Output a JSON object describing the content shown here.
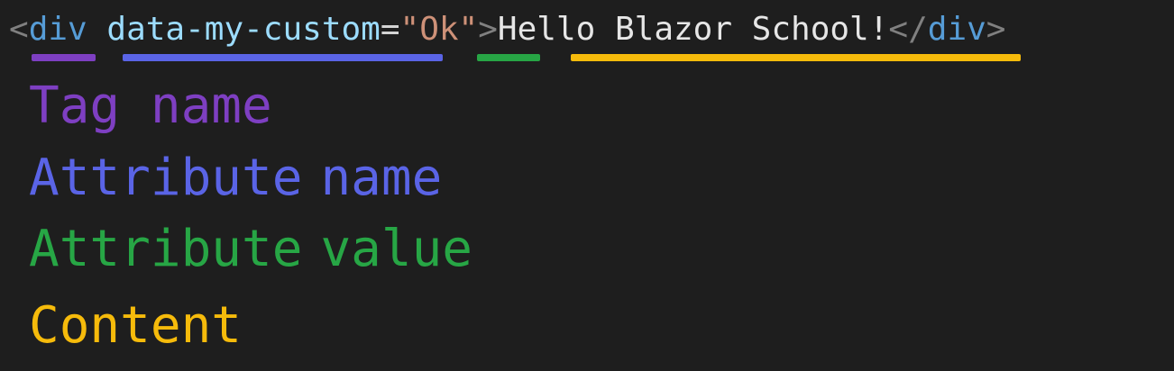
{
  "code": {
    "open_bracket": "<",
    "tag_name": "div",
    "space": " ",
    "attribute_name": "data-my-custom",
    "equals": "=",
    "attribute_value": "\"Ok\"",
    "close_bracket": ">",
    "content": "Hello Blazor School!",
    "end_tag_open": "</",
    "end_tag_name": "div",
    "end_tag_close": ">"
  },
  "legend": {
    "tag": {
      "label": "Tag name",
      "color": "#7e3fc2"
    },
    "attribute_name": {
      "word1": "Attribute",
      "word2": "name",
      "color": "#5a64e6"
    },
    "attribute_value": {
      "word1": "Attribute",
      "word2": "value",
      "color": "#27a645"
    },
    "content": {
      "label": "Content",
      "color": "#f6bb0b"
    }
  }
}
